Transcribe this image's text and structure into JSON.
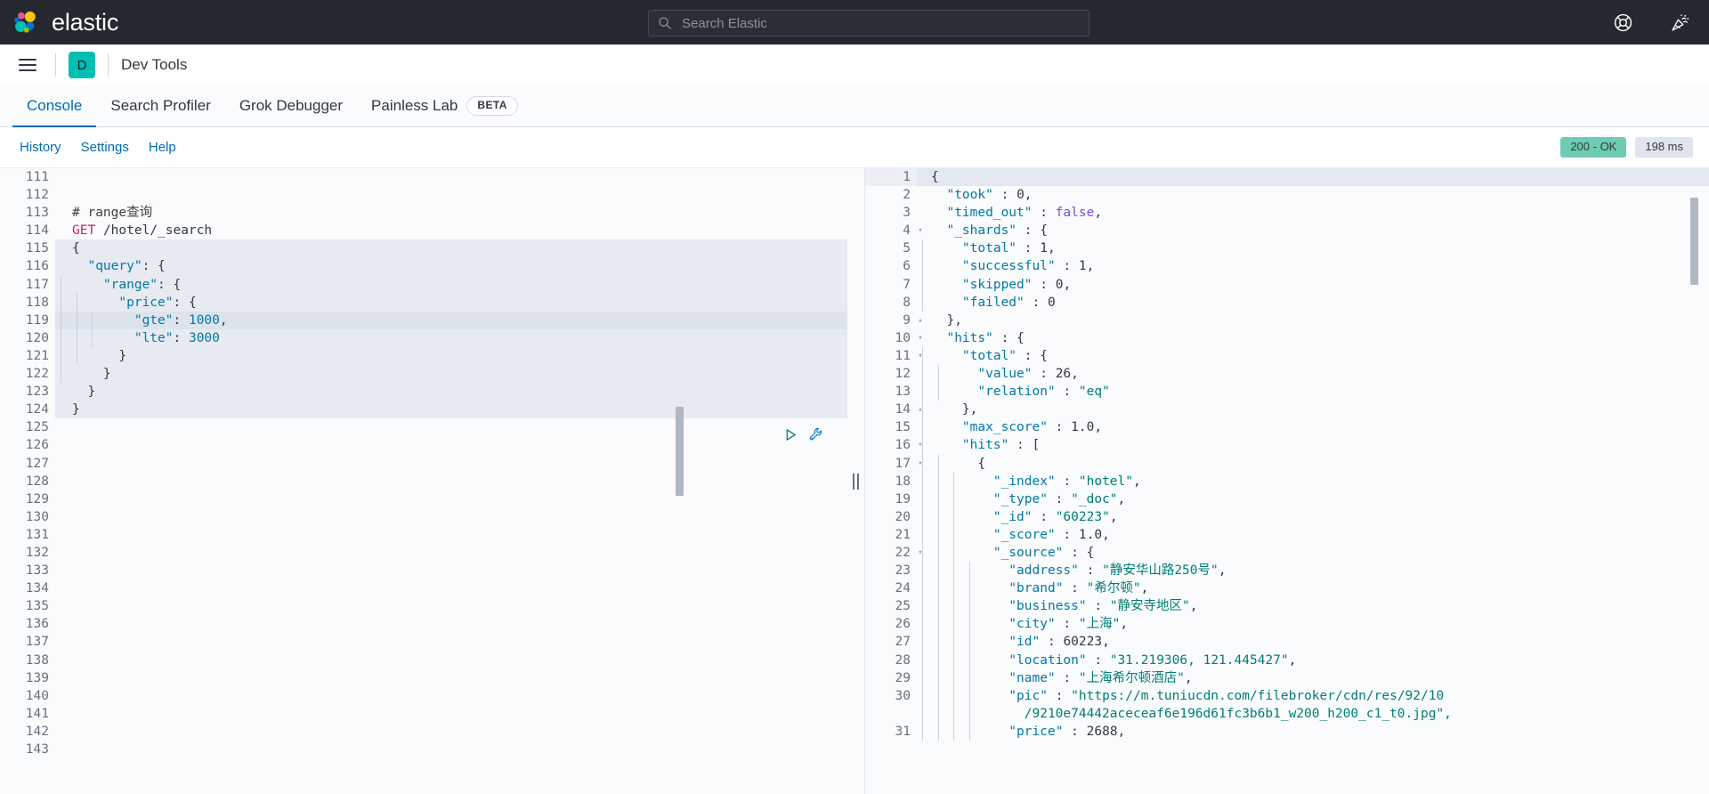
{
  "header": {
    "brand_name": "elastic",
    "logo_icon": "elastic-logo",
    "search_placeholder": "Search Elastic",
    "search_icon": "search-icon",
    "help_icon": "help-lifebuoy-icon",
    "whatsnew_icon": "party-popper-icon"
  },
  "breadcrumb": {
    "menu_icon": "hamburger-menu-icon",
    "space_initial": "D",
    "title": "Dev Tools"
  },
  "app_tabs": [
    {
      "label": "Console",
      "active": true
    },
    {
      "label": "Search Profiler",
      "active": false
    },
    {
      "label": "Grok Debugger",
      "active": false
    },
    {
      "label": "Painless Lab",
      "active": false,
      "badge": "BETA"
    }
  ],
  "console_toolbar": {
    "links": [
      "History",
      "Settings",
      "Help"
    ],
    "status_code": "200 - OK",
    "duration": "198 ms",
    "play_icon": "play-triangle-icon",
    "wrench_icon": "wrench-icon"
  },
  "editor": {
    "first_line": 111,
    "lines": [
      {
        "n": 111,
        "text": ""
      },
      {
        "n": 112,
        "text": ""
      },
      {
        "n": 113,
        "text": "# range查询",
        "kind": "comment"
      },
      {
        "n": 114,
        "text": "GET /hotel/_search",
        "kind": "request"
      },
      {
        "n": 115,
        "text": "{",
        "fold": "down",
        "sel": true,
        "indent": 0
      },
      {
        "n": 116,
        "text": "  \"query\": {",
        "fold": "down",
        "sel": true,
        "indent": 0
      },
      {
        "n": 117,
        "text": "    \"range\": {",
        "fold": "down",
        "sel": true,
        "indent": 1
      },
      {
        "n": 118,
        "text": "      \"price\": {",
        "fold": "down",
        "sel": true,
        "indent": 2
      },
      {
        "n": 119,
        "text": "        \"gte\": 1000,",
        "sel": true,
        "cursor": true,
        "indent": 3
      },
      {
        "n": 120,
        "text": "        \"lte\": 3000",
        "sel": true,
        "indent": 3
      },
      {
        "n": 121,
        "text": "      }",
        "fold": "up",
        "sel": true,
        "indent": 2
      },
      {
        "n": 122,
        "text": "    }",
        "fold": "up",
        "sel": true,
        "indent": 1
      },
      {
        "n": 123,
        "text": "  }",
        "fold": "up",
        "sel": true,
        "indent": 0
      },
      {
        "n": 124,
        "text": "}",
        "fold": "up",
        "sel": true
      },
      {
        "n": 125,
        "text": ""
      },
      {
        "n": 126,
        "text": ""
      },
      {
        "n": 127,
        "text": ""
      },
      {
        "n": 128,
        "text": ""
      },
      {
        "n": 129,
        "text": ""
      },
      {
        "n": 130,
        "text": ""
      },
      {
        "n": 131,
        "text": ""
      },
      {
        "n": 132,
        "text": ""
      },
      {
        "n": 133,
        "text": ""
      },
      {
        "n": 134,
        "text": ""
      },
      {
        "n": 135,
        "text": ""
      },
      {
        "n": 136,
        "text": ""
      },
      {
        "n": 137,
        "text": ""
      },
      {
        "n": 138,
        "text": ""
      },
      {
        "n": 139,
        "text": ""
      },
      {
        "n": 140,
        "text": ""
      },
      {
        "n": 141,
        "text": ""
      },
      {
        "n": 142,
        "text": ""
      },
      {
        "n": 143,
        "text": ""
      }
    ],
    "request": {
      "method": "GET",
      "path": "/hotel/_search",
      "comment": "# range查询",
      "body_query_field": "price",
      "gte": 1000,
      "lte": 3000
    }
  },
  "response": {
    "lines": [
      {
        "n": 1,
        "text": "{",
        "fold": "down",
        "cursor": true
      },
      {
        "n": 2,
        "text": "  \"took\" : 0,",
        "indent": 0
      },
      {
        "n": 3,
        "text": "  \"timed_out\" : false,",
        "indent": 0
      },
      {
        "n": 4,
        "text": "  \"_shards\" : {",
        "fold": "down",
        "indent": 0
      },
      {
        "n": 5,
        "text": "    \"total\" : 1,",
        "indent": 1
      },
      {
        "n": 6,
        "text": "    \"successful\" : 1,",
        "indent": 1
      },
      {
        "n": 7,
        "text": "    \"skipped\" : 0,",
        "indent": 1
      },
      {
        "n": 8,
        "text": "    \"failed\" : 0",
        "indent": 1
      },
      {
        "n": 9,
        "text": "  },",
        "fold": "up",
        "indent": 0
      },
      {
        "n": 10,
        "text": "  \"hits\" : {",
        "fold": "down",
        "indent": 0
      },
      {
        "n": 11,
        "text": "    \"total\" : {",
        "fold": "down",
        "indent": 1
      },
      {
        "n": 12,
        "text": "      \"value\" : 26,",
        "indent": 2
      },
      {
        "n": 13,
        "text": "      \"relation\" : \"eq\"",
        "indent": 2
      },
      {
        "n": 14,
        "text": "    },",
        "fold": "up",
        "indent": 1
      },
      {
        "n": 15,
        "text": "    \"max_score\" : 1.0,",
        "indent": 1
      },
      {
        "n": 16,
        "text": "    \"hits\" : [",
        "fold": "down",
        "indent": 1
      },
      {
        "n": 17,
        "text": "      {",
        "fold": "down",
        "indent": 2
      },
      {
        "n": 18,
        "text": "        \"_index\" : \"hotel\",",
        "indent": 3
      },
      {
        "n": 19,
        "text": "        \"_type\" : \"_doc\",",
        "indent": 3
      },
      {
        "n": 20,
        "text": "        \"_id\" : \"60223\",",
        "indent": 3
      },
      {
        "n": 21,
        "text": "        \"_score\" : 1.0,",
        "indent": 3
      },
      {
        "n": 22,
        "text": "        \"_source\" : {",
        "fold": "down",
        "indent": 3
      },
      {
        "n": 23,
        "text": "          \"address\" : \"静安华山路250号\",",
        "indent": 4
      },
      {
        "n": 24,
        "text": "          \"brand\" : \"希尔顿\",",
        "indent": 4
      },
      {
        "n": 25,
        "text": "          \"business\" : \"静安寺地区\",",
        "indent": 4
      },
      {
        "n": 26,
        "text": "          \"city\" : \"上海\",",
        "indent": 4
      },
      {
        "n": 27,
        "text": "          \"id\" : 60223,",
        "indent": 4
      },
      {
        "n": 28,
        "text": "          \"location\" : \"31.219306, 121.445427\",",
        "indent": 4
      },
      {
        "n": 29,
        "text": "          \"name\" : \"上海希尔顿酒店\",",
        "indent": 4
      },
      {
        "n": 30,
        "text": "          \"pic\" : \"https://m.tuniucdn.com/filebroker/cdn/res/92/10",
        "indent": 4,
        "wrap": "            /9210e74442aceceaf6e196d61fc3b6b1_w200_h200_c1_t0.jpg\","
      },
      {
        "n": 31,
        "text": "          \"price\" : 2688,",
        "indent": 4
      }
    ],
    "values": {
      "took": 0,
      "timed_out": false,
      "shards_total": 1,
      "shards_successful": 1,
      "shards_skipped": 0,
      "shards_failed": 0,
      "hits_total_value": 26,
      "hits_total_relation": "eq",
      "max_score": 1.0,
      "hit_index": "hotel",
      "hit_type": "_doc",
      "hit_id": "60223",
      "hit_score": 1.0,
      "address": "静安华山路250号",
      "brand": "希尔顿",
      "business": "静安寺地区",
      "city": "上海",
      "id": 60223,
      "location": "31.219306, 121.445427",
      "name": "上海希尔顿酒店",
      "pic": "https://m.tuniucdn.com/filebroker/cdn/res/92/10/9210e74442aceceaf6e196d61fc3b6b1_w200_h200_c1_t0.jpg",
      "price": 2688
    }
  },
  "colors": {
    "header_bg": "#25282f",
    "accent_teal": "#00bfb3",
    "link_blue": "#006bb4",
    "status_ok_bg": "#6dccb1",
    "duration_bg": "#e0e5ee"
  }
}
